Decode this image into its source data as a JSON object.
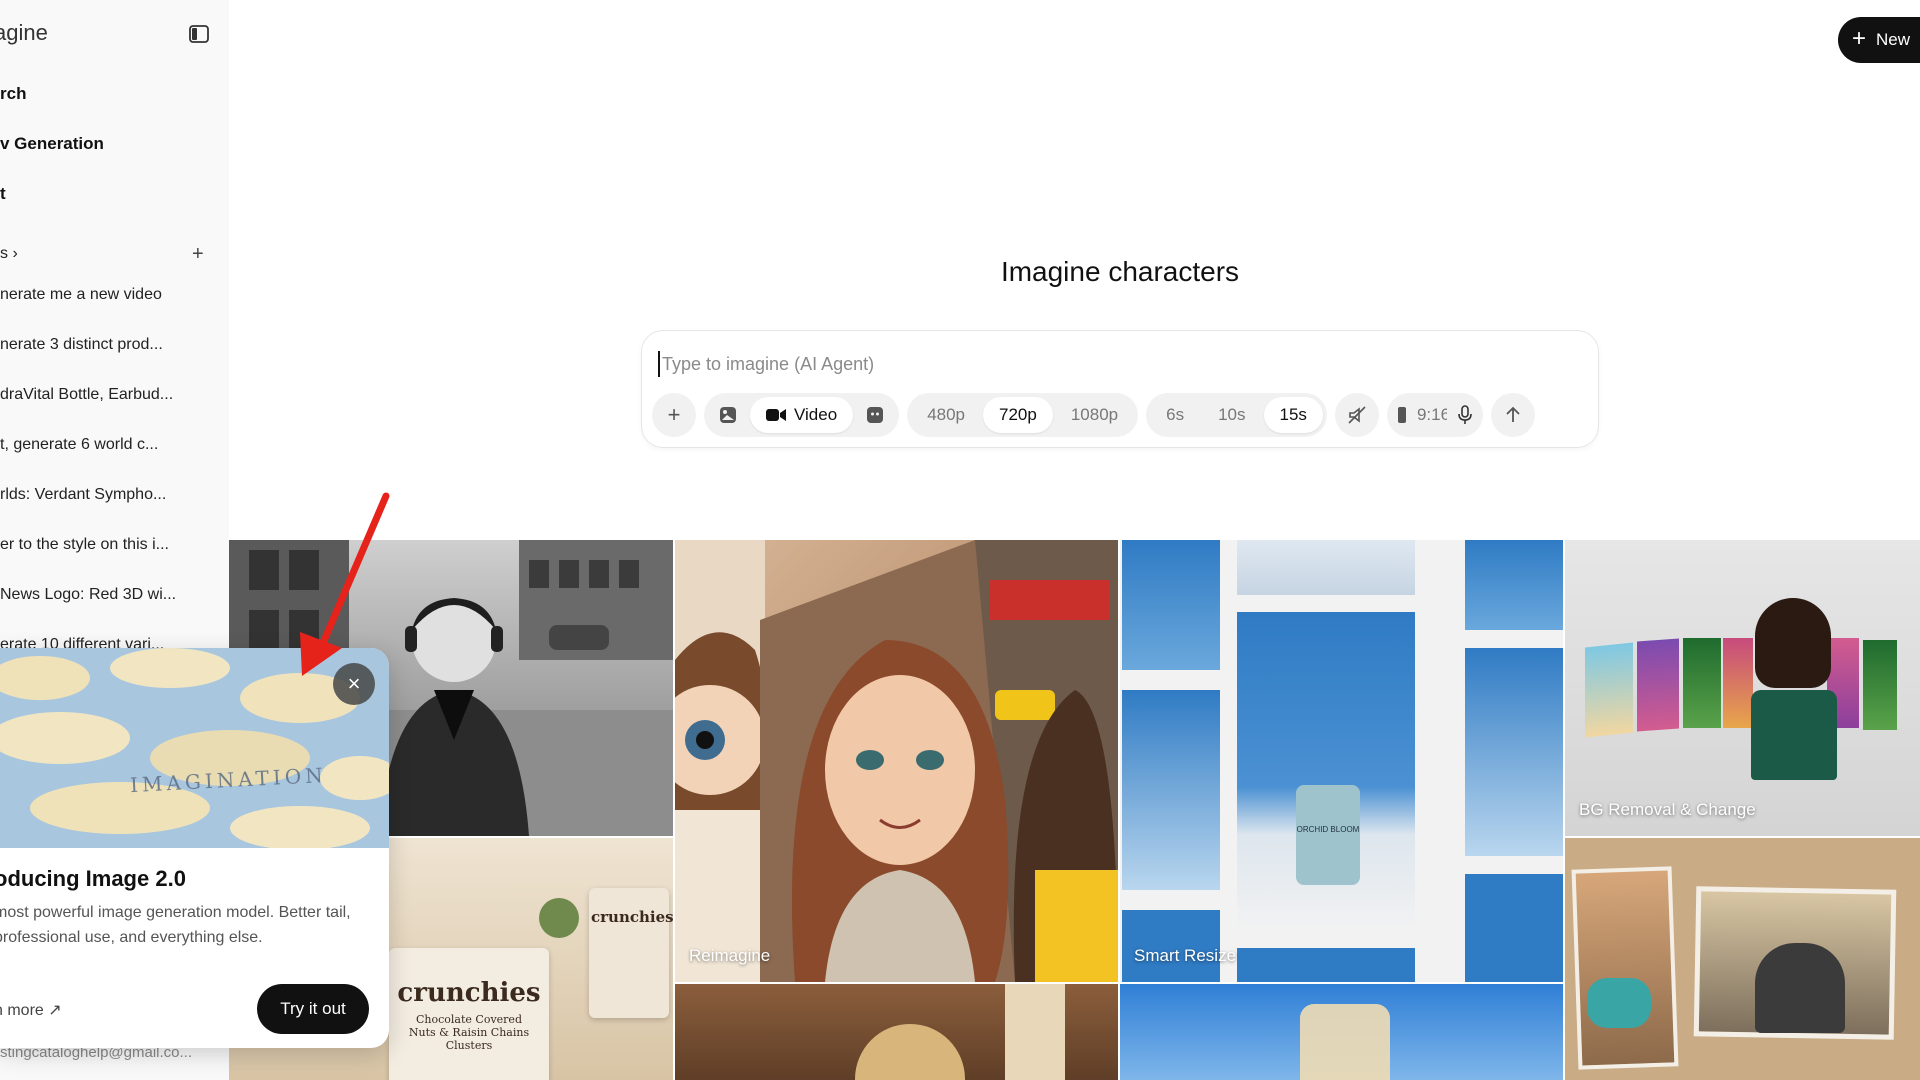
{
  "sidebar": {
    "app_title": "agine",
    "nav": [
      {
        "label": "rch"
      },
      {
        "label": "v Generation"
      },
      {
        "label": "t"
      }
    ],
    "section_label": "s ›",
    "history": [
      {
        "label": "nerate me a new video"
      },
      {
        "label": "nerate 3 distinct prod..."
      },
      {
        "label": "draVital Bottle, Earbud..."
      },
      {
        "label": "t, generate 6 world c..."
      },
      {
        "label": "rlds: Verdant Sympho..."
      },
      {
        "label": "er to the style on this i..."
      },
      {
        "label": "News Logo: Red 3D wi..."
      },
      {
        "label": "erate 10 different vari..."
      }
    ],
    "account_email": "stingcataloghelp@gmail.co..."
  },
  "header": {
    "new_button_label": "New"
  },
  "main": {
    "heading": "Imagine characters",
    "composer": {
      "placeholder": "Type to imagine (AI Agent)",
      "mode_label": "Video",
      "resolutions": [
        "480p",
        "720p",
        "1080p"
      ],
      "selected_resolution": "720p",
      "durations": [
        "6s",
        "10s",
        "15s"
      ],
      "selected_duration": "15s",
      "aspect_ratio": "9:16"
    }
  },
  "gallery": {
    "labels": {
      "reimagine": "Reimagine",
      "smart_resize": "Smart Resize",
      "bg_removal": "BG Removal & Change"
    },
    "product_packaging": {
      "brand": "crunchies",
      "subtitle": "Chocolate Covered Nuts & Raisin Chains Clusters"
    },
    "jar_label": "ORCHID BLOOM",
    "popup_image_text": "IMAGINATION"
  },
  "popup": {
    "title": "oducing Image 2.0",
    "description": "most powerful image generation model. Better tail, professional use, and everything else.",
    "learn_more": "n more ↗",
    "cta": "Try it out"
  },
  "colors": {
    "accent_dark": "#111111",
    "sidebar_bg": "#f9f9f9",
    "annotation_arrow": "#e5231b"
  }
}
